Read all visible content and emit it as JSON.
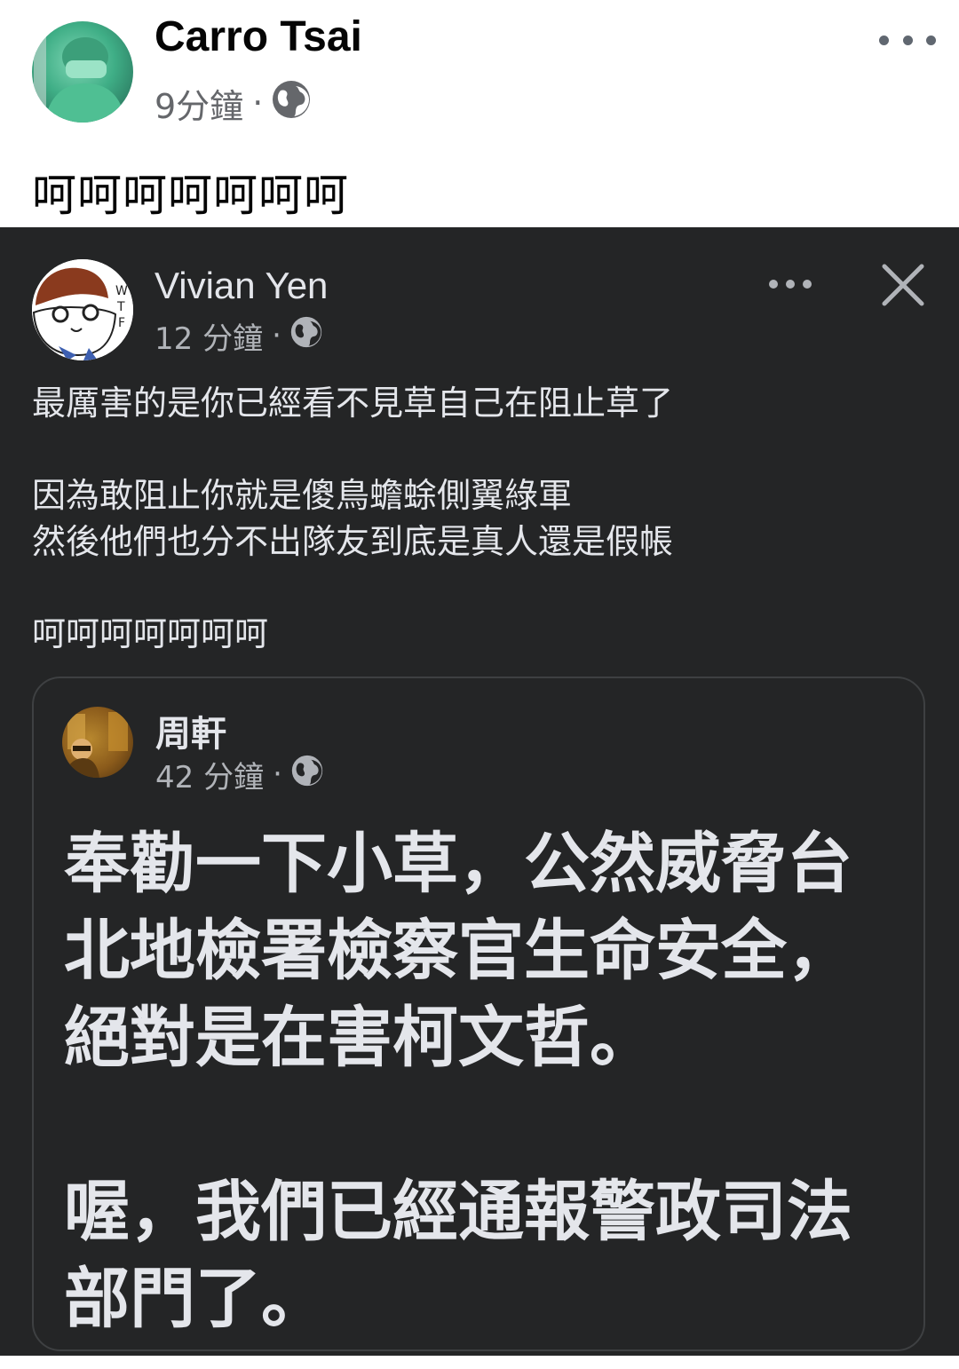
{
  "post": {
    "author": "Carro Tsai",
    "time": "9分鐘",
    "separator": "·",
    "privacy_icon": "globe-icon",
    "text": "呵呵呵呵呵呵呵"
  },
  "screenshot": {
    "author": "Vivian Yen",
    "time": "12 分鐘",
    "separator": "·",
    "privacy_icon": "globe-icon",
    "paragraphs": [
      [
        "最厲害的是你已經看不見草自己在阻止草了"
      ],
      [
        "因為敢阻止你就是傻鳥蟾蜍側翼綠軍",
        "然後他們也分不出隊友到底是真人還是假帳"
      ],
      [
        "呵呵呵呵呵呵呵"
      ]
    ],
    "shared": {
      "author": "周軒",
      "time": "42 分鐘",
      "separator": "·",
      "privacy_icon": "globe-icon",
      "lines": [
        "奉勸一下小草，公然威脅台",
        "北地檢署檢察官生命安全，",
        "絕對是在害柯文哲。",
        "",
        "喔，我們已經通報警政司法",
        "部門了。"
      ]
    }
  },
  "colors": {
    "dark_bg": "#242526",
    "dark_text": "#e4e6eb",
    "dark_secondary": "#b0b3b8",
    "light_text": "#050505",
    "light_secondary": "#65676b"
  }
}
